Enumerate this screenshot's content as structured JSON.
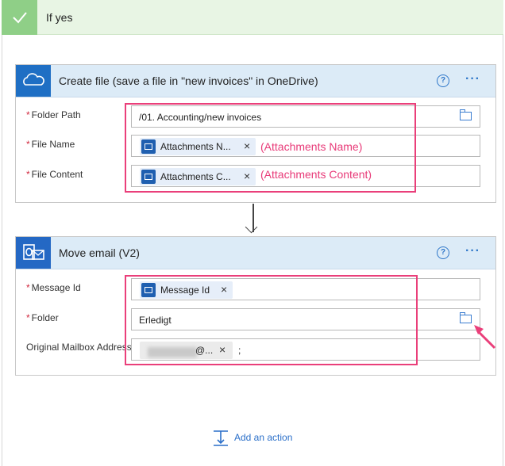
{
  "condition": {
    "title": "If yes"
  },
  "create_file": {
    "title": "Create file (save a file in \"new invoices\" in OneDrive)",
    "help": "?",
    "more": "···",
    "fields": {
      "folder_path": {
        "label": "Folder Path",
        "value": "/01. Accounting/new invoices"
      },
      "file_name": {
        "label": "File Name",
        "token": "Attachments N...",
        "annotation": "(Attachments Name)"
      },
      "file_content": {
        "label": "File Content",
        "token": "Attachments C...",
        "annotation": "(Attachments Content)"
      }
    },
    "required_marker": "*"
  },
  "move_email": {
    "title": "Move email (V2)",
    "help": "?",
    "more": "···",
    "fields": {
      "message_id": {
        "label": "Message Id",
        "token": "Message Id"
      },
      "folder": {
        "label": "Folder",
        "value": "Erledigt"
      },
      "original_mailbox": {
        "label": "Original Mailbox Address",
        "token_suffix": "@...",
        "trailing": ";"
      }
    },
    "required_marker": "*"
  },
  "token_close": "×",
  "add_action": {
    "label": "Add an action"
  },
  "colors": {
    "highlight": "#ea3f7a",
    "header_bg": "#dcebf7",
    "accent": "#2a6fc9",
    "success": "#8fcf87"
  },
  "icons": [
    "check-icon",
    "onedrive-icon",
    "outlook-icon",
    "help-icon",
    "more-icon",
    "folder-icon",
    "close-icon",
    "add-action-icon",
    "arrow-down-icon"
  ]
}
